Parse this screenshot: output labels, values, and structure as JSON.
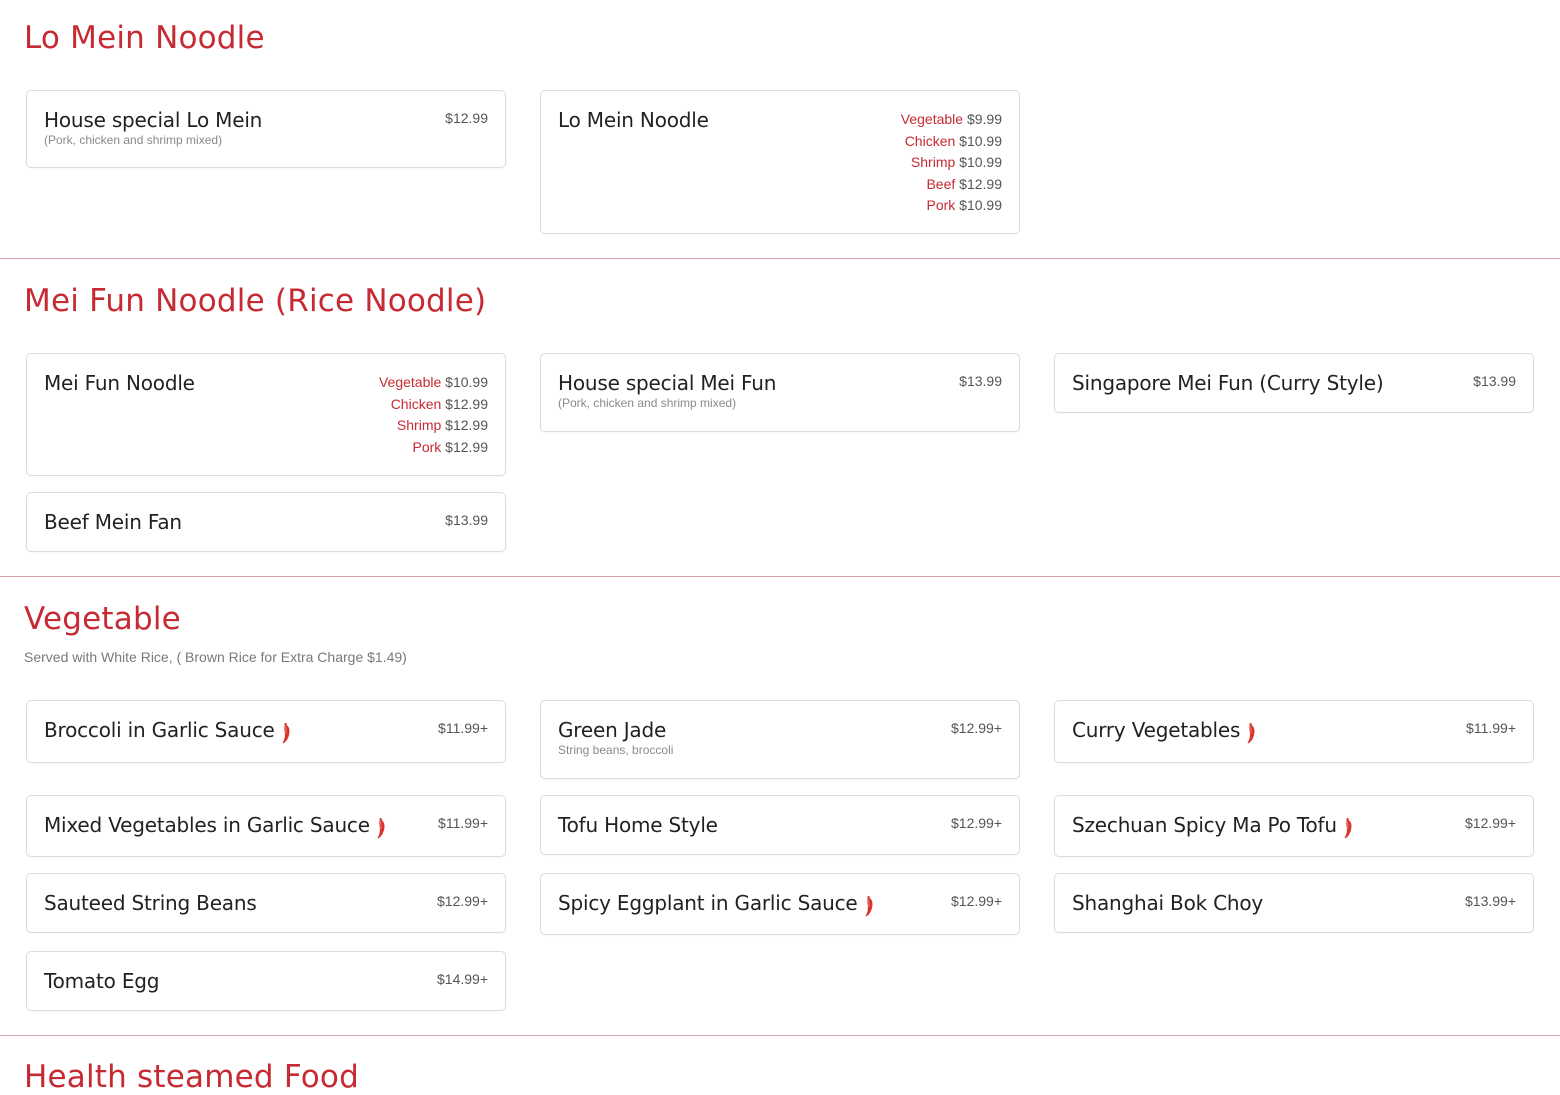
{
  "sections": {
    "lomein": {
      "title": "Lo Mein Noodle",
      "items": [
        {
          "name": "House special Lo Mein",
          "desc": "(Pork, chicken and shrimp mixed)",
          "price": "$12.99"
        },
        {
          "name": "Lo Mein Noodle",
          "options": [
            {
              "label": "Vegetable",
              "price": "$9.99"
            },
            {
              "label": "Chicken",
              "price": "$10.99"
            },
            {
              "label": "Shrimp",
              "price": "$10.99"
            },
            {
              "label": "Beef",
              "price": "$12.99"
            },
            {
              "label": "Pork",
              "price": "$10.99"
            }
          ]
        }
      ]
    },
    "meifun": {
      "title": "Mei Fun Noodle (Rice Noodle)",
      "items": [
        {
          "name": "Mei Fun Noodle",
          "options": [
            {
              "label": "Vegetable",
              "price": "$10.99"
            },
            {
              "label": "Chicken",
              "price": "$12.99"
            },
            {
              "label": "Shrimp",
              "price": "$12.99"
            },
            {
              "label": "Pork",
              "price": "$12.99"
            }
          ]
        },
        {
          "name": "House special Mei Fun",
          "desc": "(Pork, chicken and shrimp mixed)",
          "price": "$13.99"
        },
        {
          "name": "Singapore Mei Fun (Curry Style)",
          "price": "$13.99"
        },
        {
          "name": "Beef Mein Fan",
          "price": "$13.99"
        }
      ]
    },
    "vegetable": {
      "title": "Vegetable",
      "note": "Served with White Rice, ( Brown Rice for Extra Charge $1.49)",
      "items": [
        {
          "name": "Broccoli in Garlic Sauce",
          "price": "$11.99+",
          "spicy": true
        },
        {
          "name": "Green Jade",
          "desc": "String beans, broccoli",
          "price": "$12.99+"
        },
        {
          "name": "Curry Vegetables",
          "price": "$11.99+",
          "spicy": true
        },
        {
          "name": "Mixed Vegetables in Garlic Sauce",
          "price": "$11.99+",
          "spicy": true
        },
        {
          "name": "Tofu Home Style",
          "price": "$12.99+"
        },
        {
          "name": "Szechuan Spicy Ma Po Tofu",
          "price": "$12.99+",
          "spicy": true
        },
        {
          "name": "Sauteed String Beans",
          "price": "$12.99+"
        },
        {
          "name": "Spicy Eggplant in Garlic Sauce",
          "price": "$12.99+",
          "spicy": true
        },
        {
          "name": "Shanghai Bok Choy",
          "price": "$13.99+"
        },
        {
          "name": "Tomato Egg",
          "price": "$14.99+"
        }
      ]
    },
    "health": {
      "title": "Health steamed Food"
    }
  },
  "icons": {
    "spicy": "chili-pepper-icon"
  },
  "colors": {
    "accent": "#c62a33",
    "pepper": "#d9342b"
  }
}
